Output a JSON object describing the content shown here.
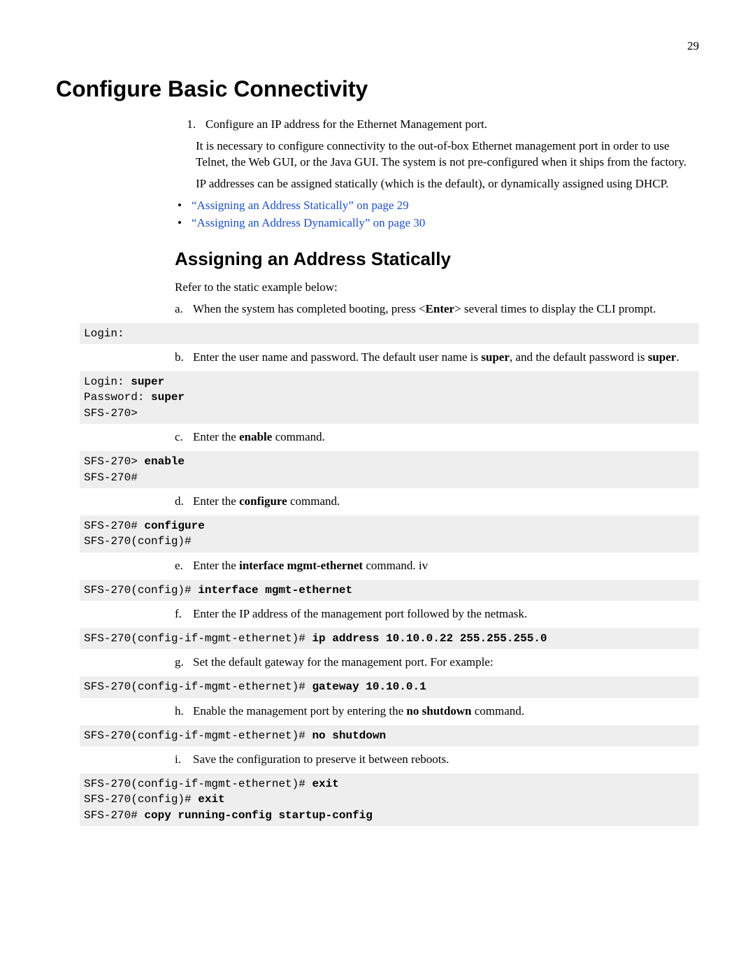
{
  "page_number": "29",
  "title": "Configure Basic Connectivity",
  "step1": {
    "num": "1.",
    "lead": "Configure an IP address for the Ethernet Management port.",
    "p1": "It is necessary to configure connectivity to the out-of-box Ethernet management port in order to use Telnet, the Web GUI, or the Java GUI. The system is not pre-configured when it ships from the factory.",
    "p2": "IP addresses can be assigned statically (which is the default), or dynamically assigned using DHCP.",
    "link1": "“Assigning an Address Statically” on page 29",
    "link2": "“Assigning an Address Dynamically” on page 30"
  },
  "section_title": "Assigning an Address Statically",
  "section_intro": "Refer to the static example below:",
  "steps": {
    "a": {
      "lbl": "a.",
      "pre": "When the system has completed booting, press <",
      "key": "Enter",
      "post": "> several times to display the CLI prompt."
    },
    "b": {
      "lbl": "b.",
      "pre": "Enter the user name and password. The default user name is ",
      "kw1": "super",
      "mid": ", and the default password is ",
      "kw2": "super",
      "post": "."
    },
    "c": {
      "lbl": "c.",
      "pre": "Enter the ",
      "kw": "enable",
      "post": " command."
    },
    "d": {
      "lbl": "d.",
      "pre": "Enter the ",
      "kw": "configure",
      "post": " command."
    },
    "e": {
      "lbl": "e.",
      "pre": "Enter the ",
      "kw": "interface mgmt-ethernet",
      "post": " command."
    },
    "f": {
      "lbl": "f.",
      "text": "Enter the IP address of the management port followed by the netmask."
    },
    "g": {
      "lbl": "g.",
      "text": "Set the default gateway for the management port. For example:"
    },
    "h": {
      "lbl": "h.",
      "pre": "Enable the management port by entering the ",
      "kw": "no shutdown",
      "post": " command."
    },
    "i": {
      "lbl": "i.",
      "text": "Save the configuration to preserve it between reboots."
    }
  },
  "code": {
    "login_prompt": "Login:",
    "login_block": {
      "l1a": "Login: ",
      "l1b": "super",
      "l2a": "Password: ",
      "l2b": "super",
      "l3": "SFS-270>"
    },
    "enable_block": {
      "l1a": "SFS-270> ",
      "l1b": "enable",
      "l2": "SFS-270#"
    },
    "configure_block": {
      "l1a": "SFS-270# ",
      "l1b": "configure",
      "l2": "SFS-270(config)#"
    },
    "interface_block": {
      "l1a": "SFS-270(config)# ",
      "l1b": "interface mgmt-ethernet"
    },
    "ip_block": {
      "l1a": "SFS-270(config-if-mgmt-ethernet)# ",
      "l1b": "ip address 10.10.0.22 255.255.255.0"
    },
    "gateway_block": {
      "l1a": "SFS-270(config-if-mgmt-ethernet)# ",
      "l1b": "gateway 10.10.0.1"
    },
    "noshut_block": {
      "l1a": "SFS-270(config-if-mgmt-ethernet)# ",
      "l1b": "no shutdown"
    },
    "save_block": {
      "l1a": "SFS-270(config-if-mgmt-ethernet)# ",
      "l1b": "exit",
      "l2a": "SFS-270(config)# ",
      "l2b": "exit",
      "l3a": "SFS-270# ",
      "l3b": "copy running-config startup-config"
    }
  }
}
